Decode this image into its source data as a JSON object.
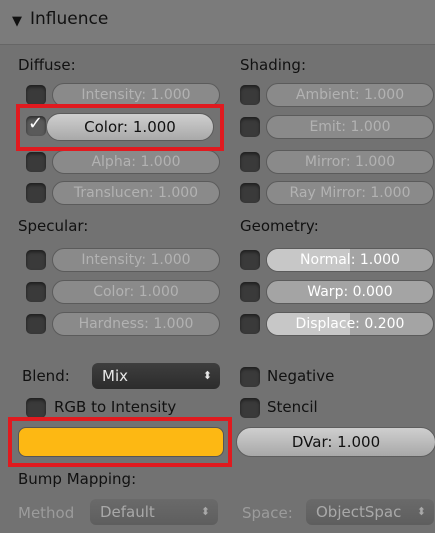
{
  "header": {
    "toggle_icon": "disclosure-triangle-down",
    "title": "Influence"
  },
  "diffuse": {
    "heading": "Diffuse:",
    "items": [
      {
        "label": "Intensity: 1.000",
        "checked": false
      },
      {
        "label": "Color: 1.000",
        "checked": true
      },
      {
        "label": "Alpha: 1.000",
        "checked": false
      },
      {
        "label": "Translucen: 1.000",
        "checked": false
      }
    ]
  },
  "shading": {
    "heading": "Shading:",
    "items": [
      {
        "label": "Ambient: 1.000",
        "checked": false
      },
      {
        "label": "Emit: 1.000",
        "checked": false
      },
      {
        "label": "Mirror: 1.000",
        "checked": false
      },
      {
        "label": "Ray Mirror: 1.000",
        "checked": false
      }
    ]
  },
  "specular": {
    "heading": "Specular:",
    "items": [
      {
        "label": "Intensity: 1.000",
        "checked": false
      },
      {
        "label": "Color: 1.000",
        "checked": false
      },
      {
        "label": "Hardness: 1.000",
        "checked": false
      }
    ]
  },
  "geometry": {
    "heading": "Geometry:",
    "items": [
      {
        "label": "Normal: 1.000",
        "checked": false,
        "fill": 0.5
      },
      {
        "label": "Warp: 0.000",
        "checked": false,
        "fill": 0.0
      },
      {
        "label": "Displace: 0.200",
        "checked": false,
        "fill": 0.5
      }
    ]
  },
  "blend": {
    "label": "Blend:",
    "value": "Mix"
  },
  "negative": {
    "label": "Negative",
    "checked": false
  },
  "rgb_to_intensity": {
    "label": "RGB to Intensity",
    "checked": false
  },
  "stencil": {
    "label": "Stencil",
    "checked": false
  },
  "color_swatch": {
    "color": "#fdb813"
  },
  "dvar": {
    "label": "DVar: 1.000"
  },
  "bump": {
    "heading": "Bump Mapping:",
    "method_label": "Method",
    "method_value": "Default",
    "space_label": "Space:",
    "space_value": "ObjectSpac"
  },
  "colors": {
    "highlight": "#e01a1f",
    "swatch": "#fdb813"
  }
}
